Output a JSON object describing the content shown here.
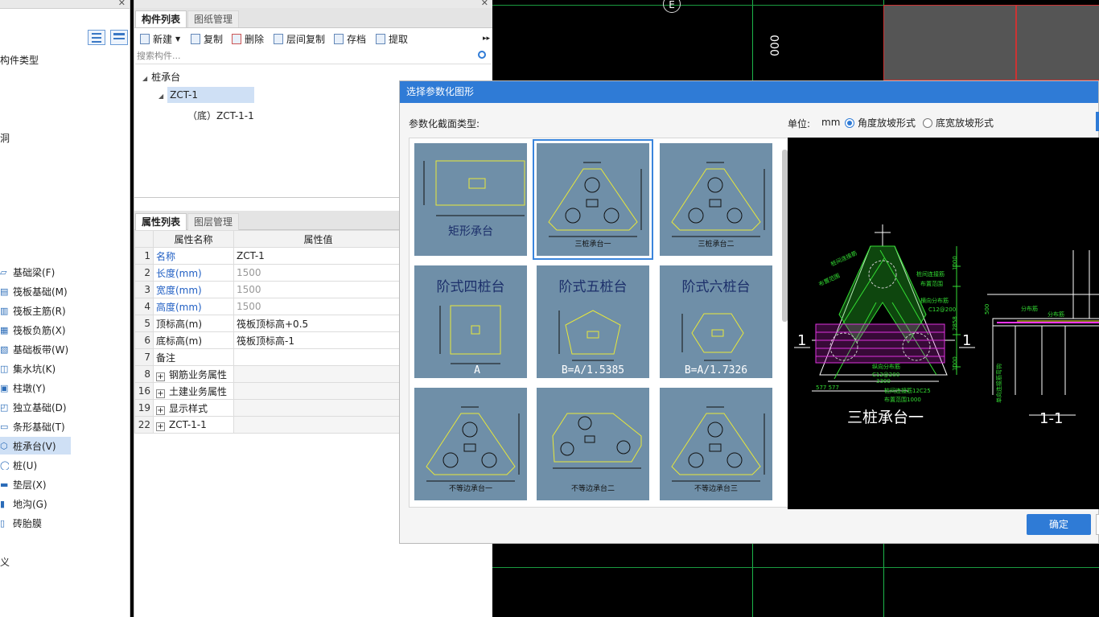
{
  "nav": {
    "top_text_1": "构件类型",
    "top_text_2": "洞",
    "bottom_text": "义",
    "items": [
      {
        "label": "基础梁(F)"
      },
      {
        "label": "筏板基础(M)"
      },
      {
        "label": "筏板主筋(R)"
      },
      {
        "label": "筏板负筋(X)"
      },
      {
        "label": "基础板带(W)"
      },
      {
        "label": "集水坑(K)"
      },
      {
        "label": "柱墩(Y)"
      },
      {
        "label": "独立基础(D)"
      },
      {
        "label": "条形基础(T)"
      },
      {
        "label": "桩承台(V)"
      },
      {
        "label": "桩(U)"
      },
      {
        "label": "垫层(X)"
      },
      {
        "label": "地沟(G)"
      },
      {
        "label": "砖胎膜"
      }
    ]
  },
  "components": {
    "tab_active": "构件列表",
    "tab_other": "图纸管理",
    "toolbar": {
      "new": "新建",
      "copy": "复制",
      "delete": "删除",
      "floor_copy": "层间复制",
      "save": "存档",
      "extract": "提取"
    },
    "search_placeholder": "搜索构件...",
    "tree": {
      "root": "桩承台",
      "child": "ZCT-1",
      "grandchild": "（底）ZCT-1-1"
    }
  },
  "properties": {
    "tab_active": "属性列表",
    "tab_other": "图层管理",
    "col_name": "属性名称",
    "col_value": "属性值",
    "rows": [
      {
        "n": "1",
        "k": "名称",
        "v": "ZCT-1"
      },
      {
        "n": "2",
        "k": "长度(mm)",
        "v": "1500"
      },
      {
        "n": "3",
        "k": "宽度(mm)",
        "v": "1500"
      },
      {
        "n": "4",
        "k": "高度(mm)",
        "v": "1500"
      },
      {
        "n": "5",
        "k": "顶标高(m)",
        "v": "筏板顶标高+0.5"
      },
      {
        "n": "6",
        "k": "底标高(m)",
        "v": "筏板顶标高-1"
      },
      {
        "n": "7",
        "k": "备注",
        "v": ""
      },
      {
        "n": "8",
        "k": "钢筋业务属性",
        "v": ""
      },
      {
        "n": "16",
        "k": "土建业务属性",
        "v": ""
      },
      {
        "n": "19",
        "k": "显示样式",
        "v": ""
      },
      {
        "n": "22",
        "k": "ZCT-1-1",
        "v": ""
      }
    ]
  },
  "cad": {
    "axis_label": "E",
    "dim_text": "000"
  },
  "dialog": {
    "title": "选择参数化图形",
    "section_label": "参数化截面类型:",
    "unit_label": "单位:",
    "unit_value": "mm",
    "radio_angle": "角度放坡形式",
    "radio_width": "底宽放坡形式",
    "ok": "确定",
    "shapes": [
      {
        "label": "矩形承台"
      },
      {
        "label": "三桩承台一"
      },
      {
        "label": "三桩承台二"
      },
      {
        "label": "阶式四桩台",
        "formula": "A"
      },
      {
        "label": "阶式五桩台",
        "formula": "B=A/1.5385"
      },
      {
        "label": "阶式六桩台",
        "formula": "B=A/1.7326"
      },
      {
        "label": "不等边承台一"
      },
      {
        "label": "不等边承台二"
      },
      {
        "label": "不等边承台三"
      }
    ],
    "preview": {
      "caption": "三桩承台一",
      "section_mark": "1",
      "section_caption": "1-1"
    }
  }
}
